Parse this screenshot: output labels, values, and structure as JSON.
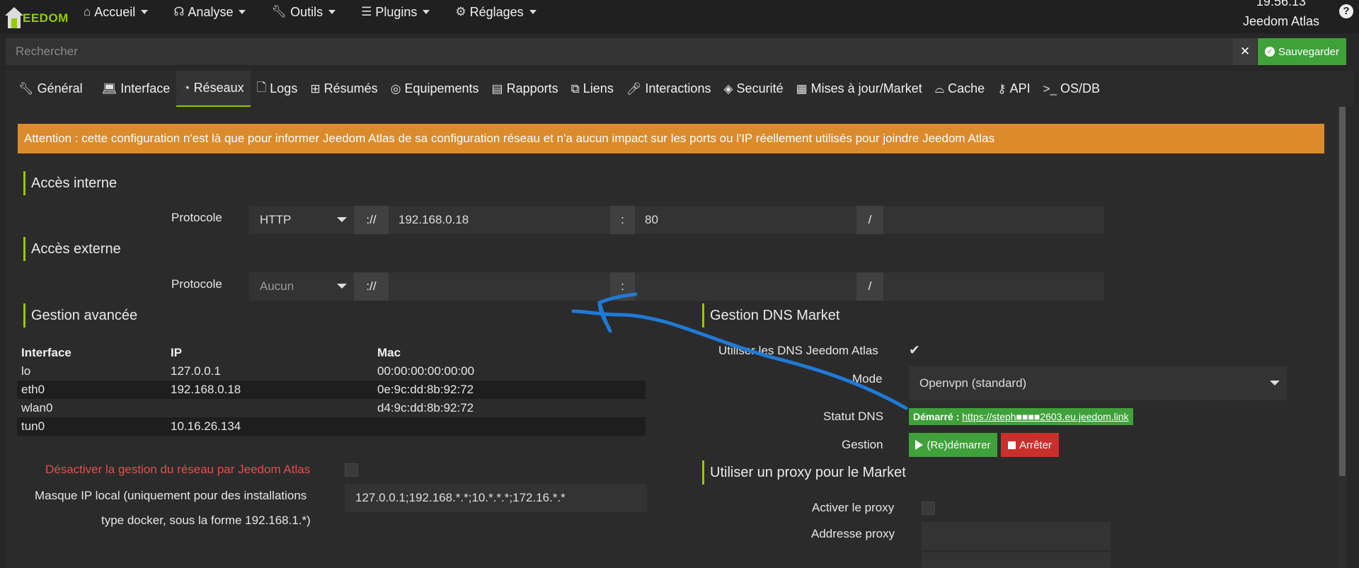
{
  "navbar": {
    "logo_text": "EEDOM",
    "menu": [
      {
        "label": "Accueil",
        "icon": "home-icon"
      },
      {
        "label": "Analyse",
        "icon": "stethoscope-icon"
      },
      {
        "label": "Outils",
        "icon": "wrench-icon"
      },
      {
        "label": "Plugins",
        "icon": "list-icon"
      },
      {
        "label": "Réglages",
        "icon": "gear-icon"
      }
    ],
    "clock": "19:56:13",
    "system_name": "Jeedom Atlas",
    "help_label": "?"
  },
  "search": {
    "placeholder": "Rechercher",
    "clear_label": "✕",
    "save_label": "Sauvegarder"
  },
  "tabs": [
    {
      "label": "Général",
      "icon": "wrench-icon"
    },
    {
      "label": "Interface",
      "icon": "laptop-icon"
    },
    {
      "label": "Réseaux",
      "icon": "rss-icon",
      "active": true
    },
    {
      "label": "Logs",
      "icon": "file-icon"
    },
    {
      "label": "Résumés",
      "icon": "table-icon"
    },
    {
      "label": "Equipements",
      "icon": "cube-icon"
    },
    {
      "label": "Rapports",
      "icon": "report-icon"
    },
    {
      "label": "Liens",
      "icon": "sitemap-icon"
    },
    {
      "label": "Interactions",
      "icon": "microphone-icon"
    },
    {
      "label": "Securité",
      "icon": "shield-icon"
    },
    {
      "label": "Mises à jour/Market",
      "icon": "update-icon"
    },
    {
      "label": "Cache",
      "icon": "hdd-icon"
    },
    {
      "label": "API",
      "icon": "key-icon"
    },
    {
      "label": "OS/DB",
      "icon": "terminal-icon"
    }
  ],
  "alert": "Attention : cette configuration n'est là que pour informer Jeedom Atlas de sa configuration réseau et n'a aucun impact sur les ports ou l'IP réellement utilisés pour joindre Jeedom Atlas",
  "internal": {
    "title": "Accès interne",
    "protocol_label": "Protocole",
    "protocol": "HTTP",
    "sep1": "://",
    "address": "192.168.0.18",
    "sep2": ":",
    "port": "80",
    "sep3": "/",
    "path": ""
  },
  "external": {
    "title": "Accès externe",
    "protocol_label": "Protocole",
    "protocol": "Aucun",
    "sep1": "://",
    "address": "",
    "sep2": ":",
    "port": "",
    "sep3": "/",
    "path": ""
  },
  "advanced": {
    "title": "Gestion avancée",
    "columns": [
      "Interface",
      "IP",
      "Mac"
    ],
    "rows": [
      [
        "lo",
        "127.0.0.1",
        "00:00:00:00:00:00"
      ],
      [
        "eth0",
        "192.168.0.18",
        "0e:9c:dd:8b:92:72"
      ],
      [
        "wlan0",
        "",
        "d4:9c:dd:8b:92:72"
      ],
      [
        "tun0",
        "10.16.26.134",
        ""
      ]
    ],
    "disable_label": "Désactiver la gestion du réseau par Jeedom Atlas",
    "mask_label_line1": "Masque IP local (uniquement pour des installations",
    "mask_label_line2": "type docker, sous la forme 192.168.1.*)",
    "mask_value": "127.0.0.1;192.168.*.*;10.*.*.*;172.16.*.*"
  },
  "dns": {
    "title": "Gestion DNS Market",
    "use_label": "Utiliser les DNS Jeedom Atlas",
    "use_checked": "✔",
    "mode_label": "Mode",
    "mode_value": "Openvpn (standard)",
    "status_label": "Statut DNS",
    "status_prefix": "Démarré :",
    "status_link": "https://steph■■■■2603.eu.jeedom.link",
    "manage_label": "Gestion",
    "restart_label": "(Re)démarrer",
    "stop_label": "Arrêter"
  },
  "proxy": {
    "title": "Utiliser un proxy pour le Market",
    "enable_label": "Activer le proxy",
    "address_label": "Addresse proxy",
    "address_value": ""
  },
  "colors": {
    "accent": "#94ca02",
    "alert": "#db8b2c",
    "success": "#3fa13a",
    "danger": "#c9302c",
    "annotation": "#1f7ad6",
    "warning_text": "#e04f4f"
  }
}
